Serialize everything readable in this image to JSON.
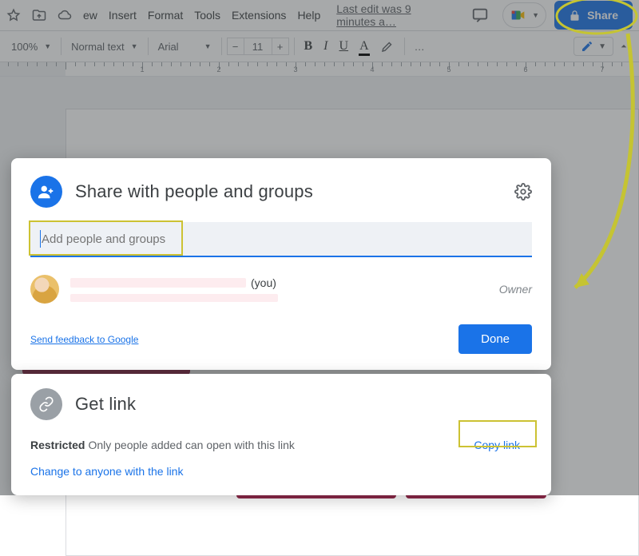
{
  "menubar": {
    "items": [
      "ew",
      "Insert",
      "Format",
      "Tools",
      "Extensions",
      "Help"
    ],
    "last_edit": "Last edit was 9 minutes a…",
    "share_label": "Share"
  },
  "toolbar": {
    "zoom": "100%",
    "style": "Normal text",
    "font": "Arial",
    "font_size": "11",
    "minus": "−",
    "plus": "+",
    "bold": "B",
    "italic": "I",
    "underline": "U",
    "text_color": "A",
    "more": "…"
  },
  "ruler": {
    "labels": [
      "1",
      "2",
      "3",
      "4",
      "5",
      "6",
      "7"
    ]
  },
  "share_dialog": {
    "title": "Share with people and groups",
    "input_placeholder": "Add people and groups",
    "you_suffix": "(you)",
    "role": "Owner",
    "feedback": "Send feedback to Google",
    "done": "Done"
  },
  "link_dialog": {
    "title": "Get link",
    "restricted_label": "Restricted",
    "restricted_desc": "Only people added can open with this link",
    "change": "Change to anyone with the link",
    "copy": "Copy link"
  }
}
